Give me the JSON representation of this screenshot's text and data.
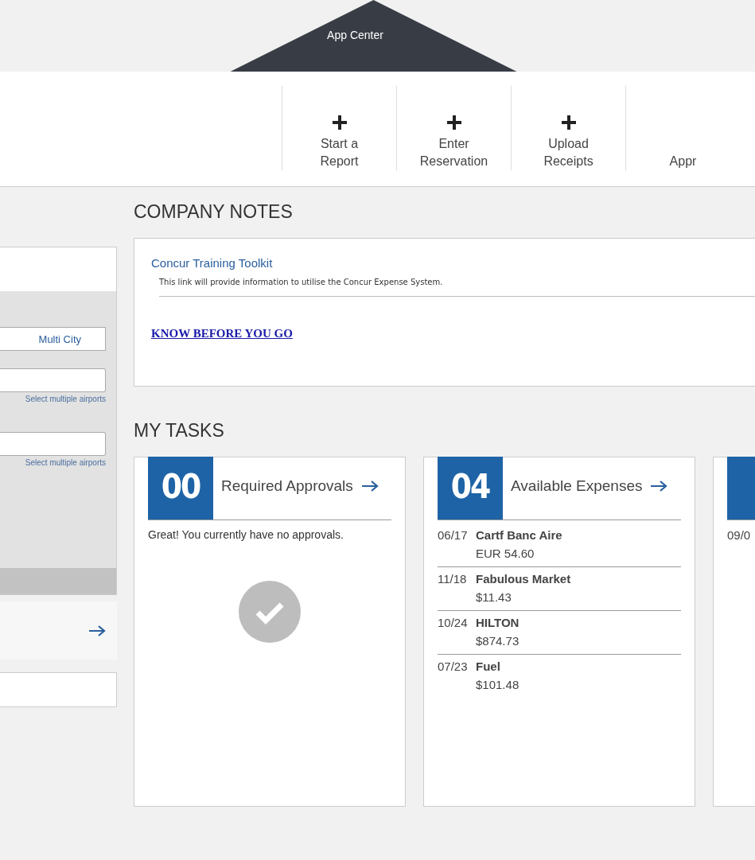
{
  "app_center": {
    "title": "App Center"
  },
  "quick_actions": [
    {
      "lines": [
        "Start a",
        "Report"
      ],
      "show_icon": true
    },
    {
      "lines": [
        "Enter",
        "Reservation"
      ],
      "show_icon": true
    },
    {
      "lines": [
        "Upload",
        "Receipts"
      ],
      "show_icon": true
    },
    {
      "lines": [
        "Appr"
      ],
      "show_icon": false
    }
  ],
  "travel_widget": {
    "trip_type_button": "Multi City",
    "airport_fields": [
      {
        "link": "Select multiple airports"
      },
      {
        "link": "Select multiple airports"
      }
    ]
  },
  "company_notes": {
    "heading": "COMPANY NOTES",
    "items": [
      {
        "title": "Concur Training Toolkit",
        "description": "This link will provide information to utilise the Concur Expense System."
      }
    ],
    "link": "KNOW BEFORE YOU GO"
  },
  "my_tasks": {
    "heading": "MY TASKS",
    "cards": [
      {
        "kind": "empty",
        "count": "00",
        "title": "Required Approvals",
        "message": "Great! You currently have no approvals."
      },
      {
        "kind": "list",
        "count": "04",
        "title": "Available Expenses",
        "items": [
          {
            "date": "06/17",
            "name": "Cartf Banc Aire",
            "amount": "EUR 54.60"
          },
          {
            "date": "11/18",
            "name": "Fabulous Market",
            "amount": "$11.43"
          },
          {
            "date": "10/24",
            "name": "HILTON",
            "amount": "$874.73"
          },
          {
            "date": "07/23",
            "name": "Fuel",
            "amount": "$101.48"
          }
        ]
      },
      {
        "kind": "list",
        "items": [
          {
            "date": "09/0"
          }
        ]
      }
    ]
  }
}
